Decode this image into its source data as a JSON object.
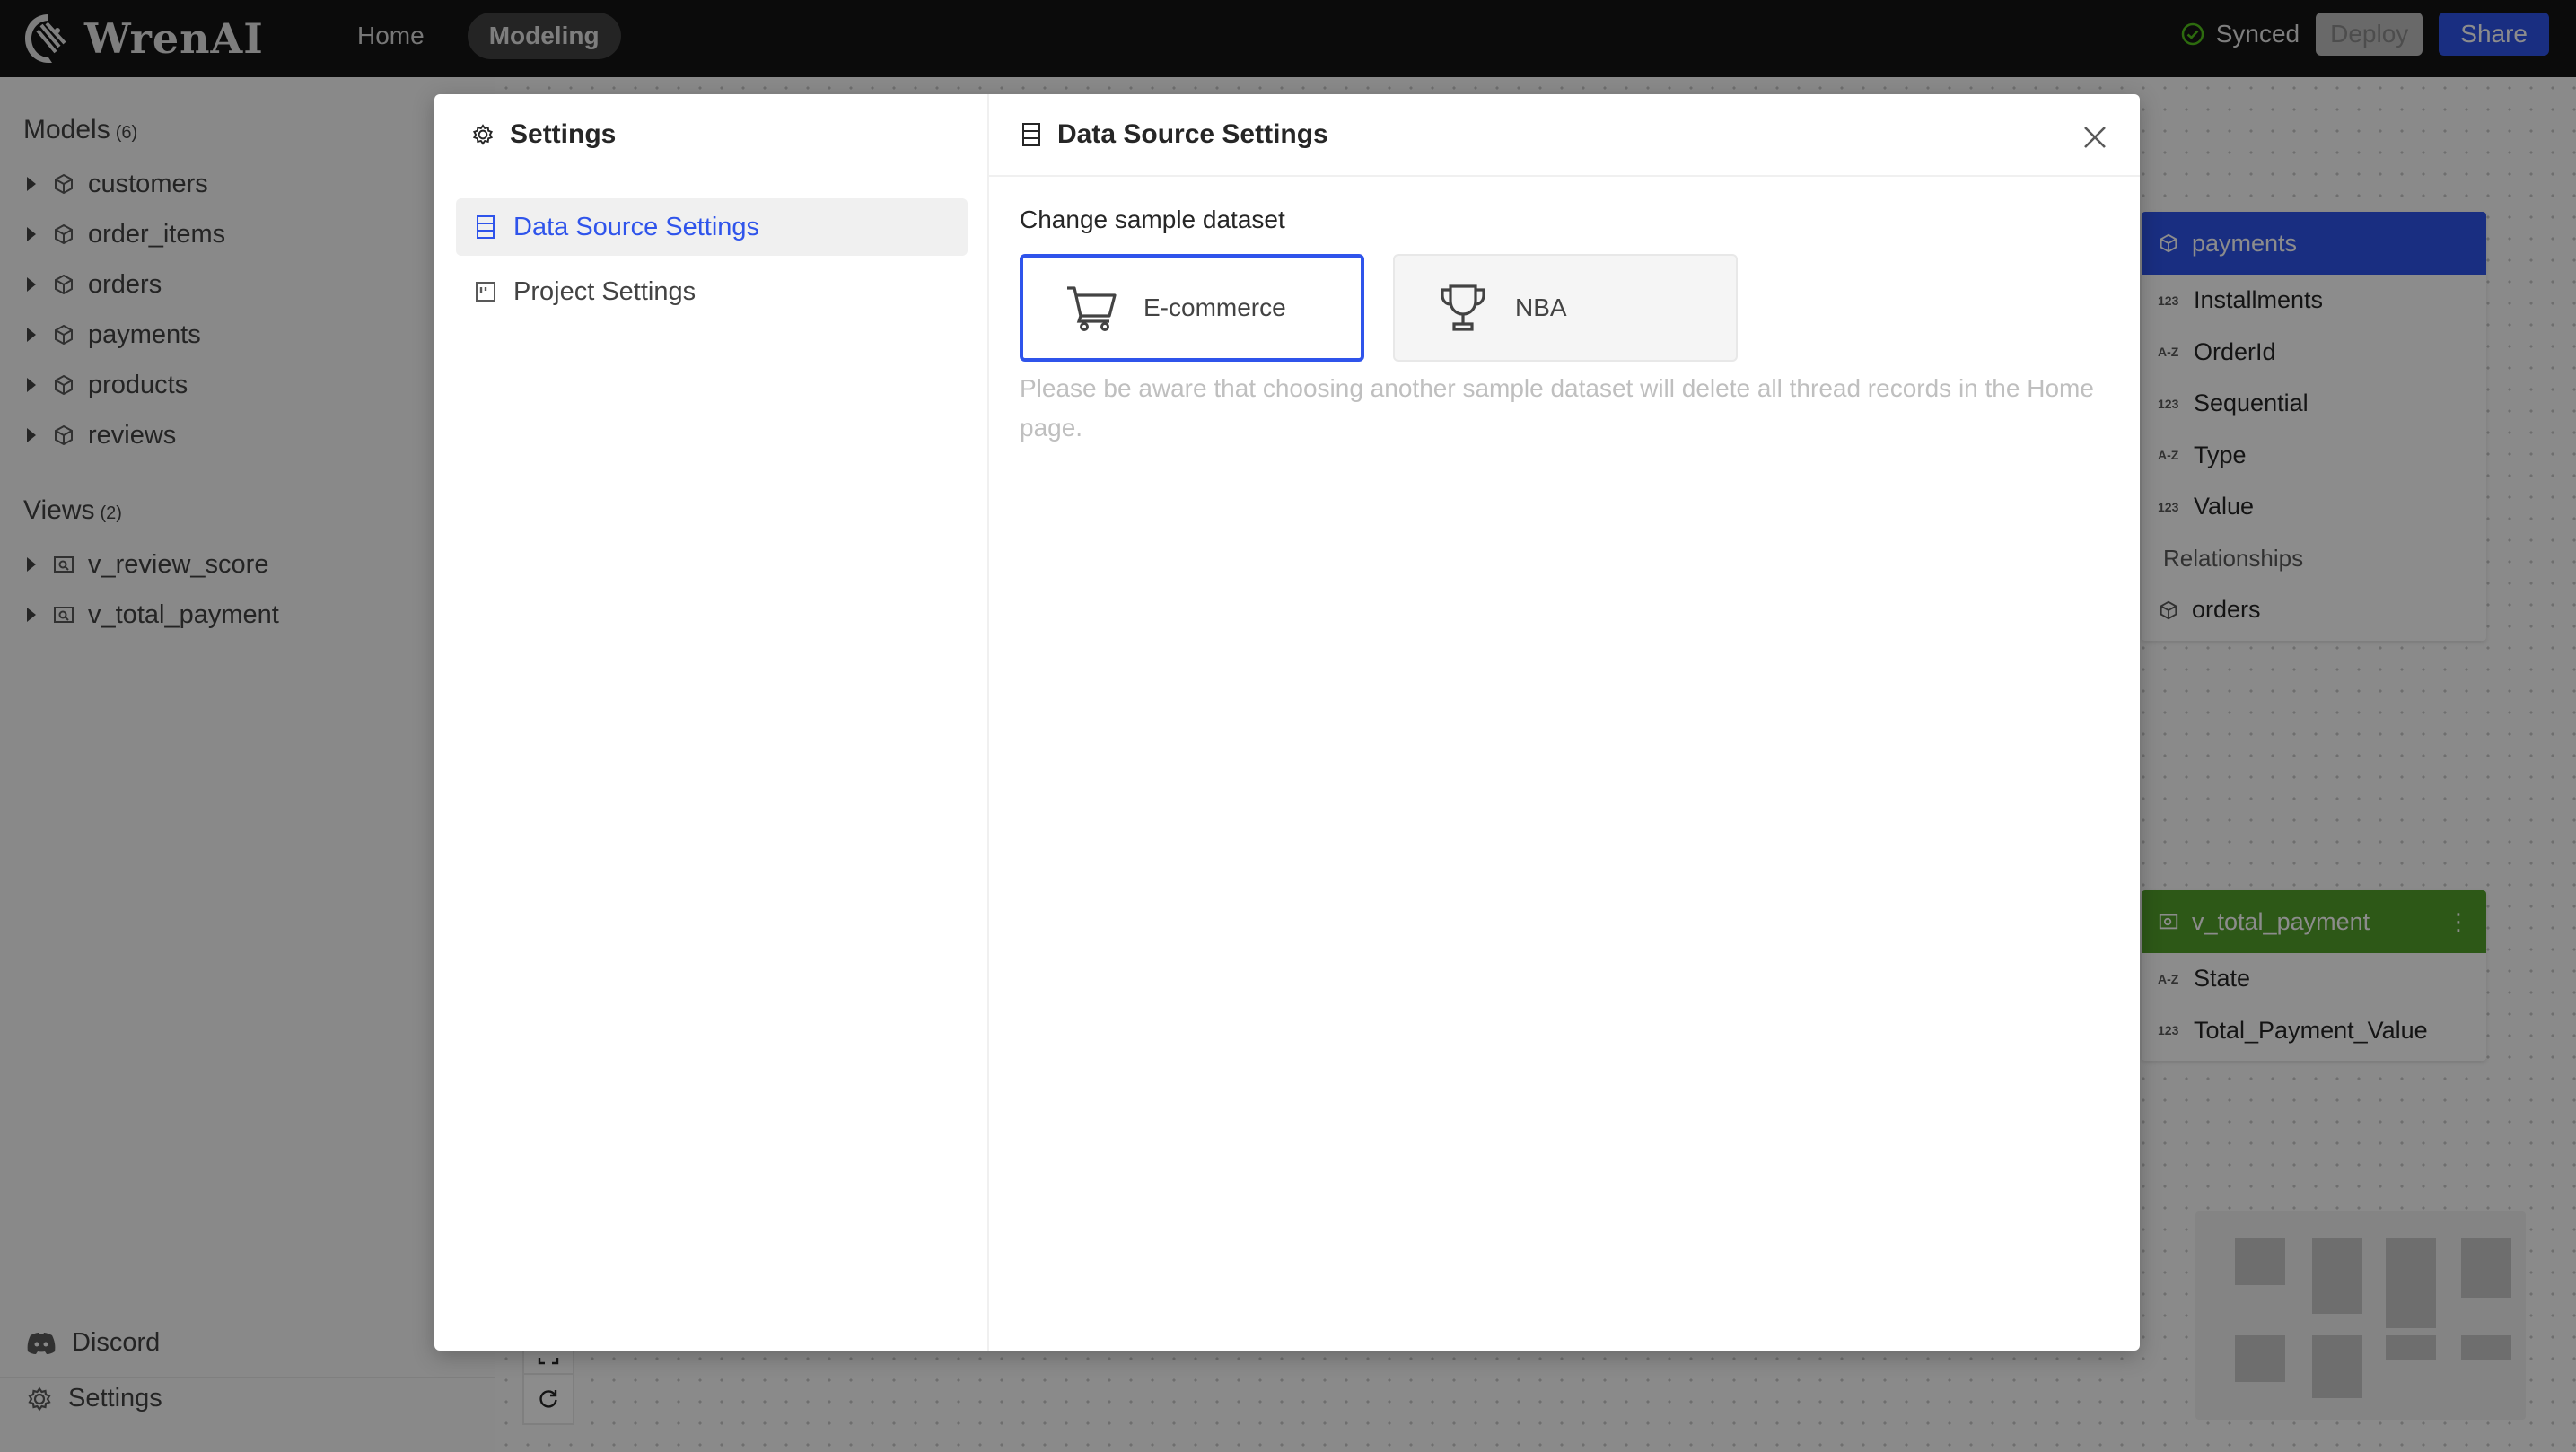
{
  "app": {
    "name": "WrenAI"
  },
  "nav": {
    "home": "Home",
    "modeling": "Modeling"
  },
  "status": {
    "synced": "Synced",
    "deploy": "Deploy",
    "share": "Share"
  },
  "sidebar": {
    "models_label": "Models",
    "models_count": "(6)",
    "models": [
      "customers",
      "order_items",
      "orders",
      "payments",
      "products",
      "reviews"
    ],
    "views_label": "Views",
    "views_count": "(2)",
    "views": [
      "v_review_score",
      "v_total_payment"
    ],
    "discord": "Discord",
    "settings": "Settings"
  },
  "canvas": {
    "payments_node": {
      "title": "payments",
      "fields": [
        {
          "type": "123",
          "name": "Installments"
        },
        {
          "type": "A-Z",
          "name": "OrderId"
        },
        {
          "type": "123",
          "name": "Sequential"
        },
        {
          "type": "A-Z",
          "name": "Type"
        },
        {
          "type": "123",
          "name": "Value"
        }
      ],
      "relationships_label": "Relationships",
      "relationship": "orders"
    },
    "view_node": {
      "title": "v_total_payment",
      "fields": [
        {
          "type": "A-Z",
          "name": "State"
        },
        {
          "type": "123",
          "name": "Total_Payment_Value"
        }
      ]
    }
  },
  "modal": {
    "title": "Settings",
    "menu": {
      "data_source": "Data Source Settings",
      "project": "Project Settings"
    },
    "panel_title": "Data Source Settings",
    "section_label": "Change sample dataset",
    "datasets": {
      "ecommerce": "E-commerce",
      "nba": "NBA"
    },
    "warning": "Please be aware that choosing another sample dataset will delete all thread records in the Home page."
  },
  "colors": {
    "accent": "#2f54eb",
    "view_green": "#52a02a",
    "topbar": "#141414"
  }
}
